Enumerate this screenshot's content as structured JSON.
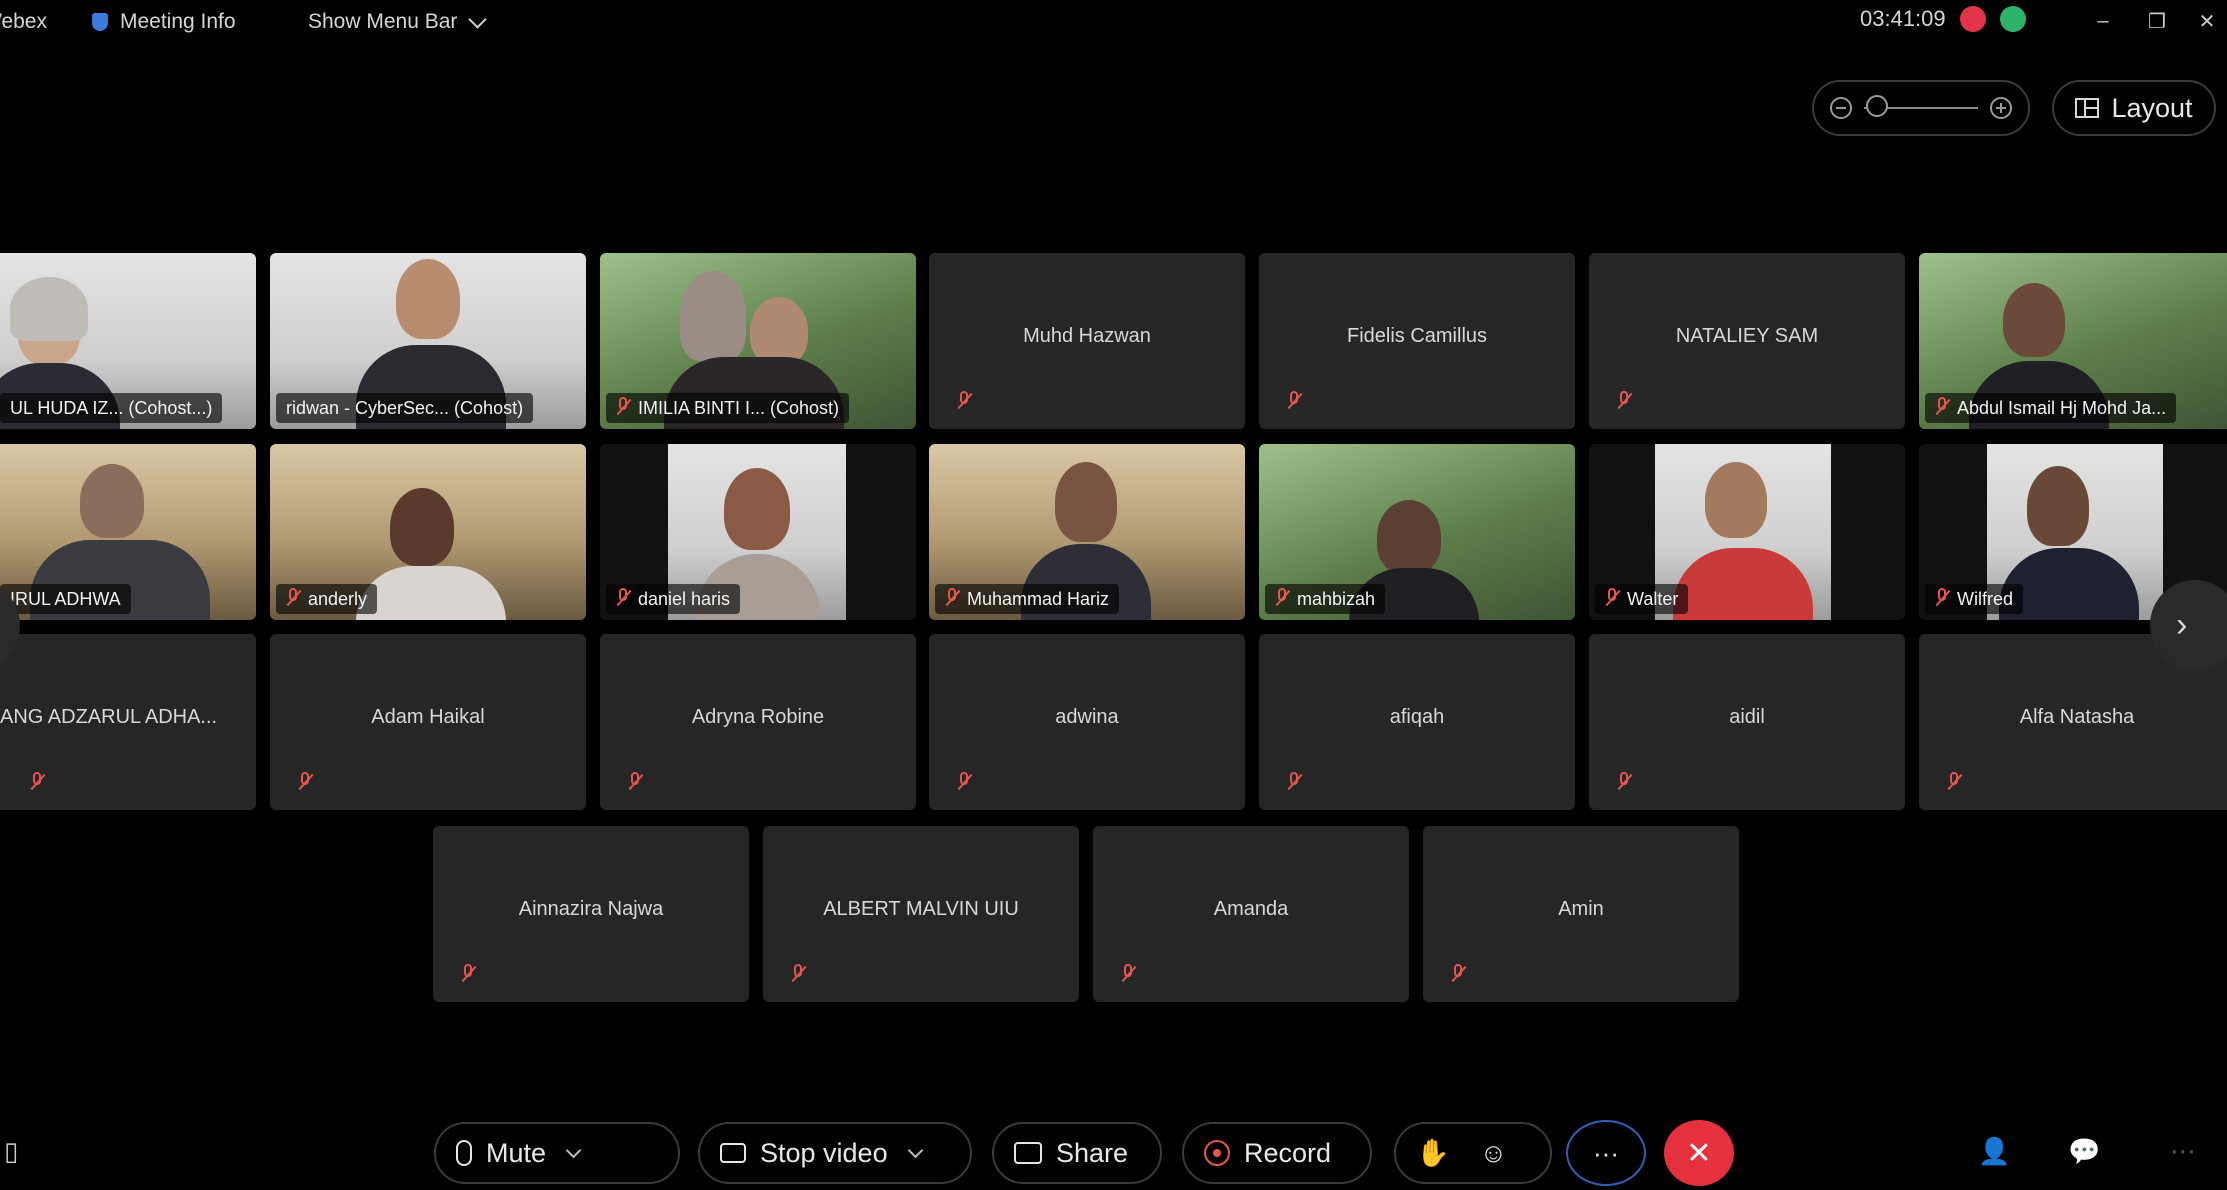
{
  "topbar": {
    "app_name": "Webex",
    "meeting_info": "Meeting Info",
    "show_menu_bar": "Show Menu Bar",
    "clock": "03:41:09",
    "minimize": "–",
    "restore": "❐",
    "close": "✕"
  },
  "view": {
    "layout_label": "Layout"
  },
  "participants": [
    {
      "name": "UL HUDA IZ... (Cohost...)",
      "video": true
    },
    {
      "name": "ridwan - CyberSec... (Cohost)",
      "video": true
    },
    {
      "name": "IMILIA BINTI I... (Cohost)",
      "video": true
    },
    {
      "name": "Muhd Hazwan",
      "video": false
    },
    {
      "name": "Fidelis Camillus",
      "video": false
    },
    {
      "name": "NATALIEY SAM",
      "video": false
    },
    {
      "name": "Abdul Ismail Hj Mohd Ja...",
      "video": true
    },
    {
      "name": "IRUL ADHWA",
      "video": true
    },
    {
      "name": "anderly",
      "video": true
    },
    {
      "name": "daniel haris",
      "video": true
    },
    {
      "name": "Muhammad Hariz",
      "video": true
    },
    {
      "name": "mahbizah",
      "video": true
    },
    {
      "name": "Walter",
      "video": true
    },
    {
      "name": "Wilfred",
      "video": true
    },
    {
      "name": "ANG ADZARUL ADHA...",
      "video": false
    },
    {
      "name": "Adam Haikal",
      "video": false
    },
    {
      "name": "Adryna Robine",
      "video": false
    },
    {
      "name": "adwina",
      "video": false
    },
    {
      "name": "afiqah",
      "video": false
    },
    {
      "name": "aidil",
      "video": false
    },
    {
      "name": "Alfa Natasha",
      "video": false
    },
    {
      "name": "Ainnazira Najwa",
      "video": false
    },
    {
      "name": "ALBERT MALVIN UIU",
      "video": false
    },
    {
      "name": "Amanda",
      "video": false
    },
    {
      "name": "Amin",
      "video": false
    }
  ],
  "controls": {
    "mute": "Mute",
    "stop_video": "Stop video",
    "share": "Share",
    "record": "Record",
    "more": "···",
    "end": "✕"
  }
}
